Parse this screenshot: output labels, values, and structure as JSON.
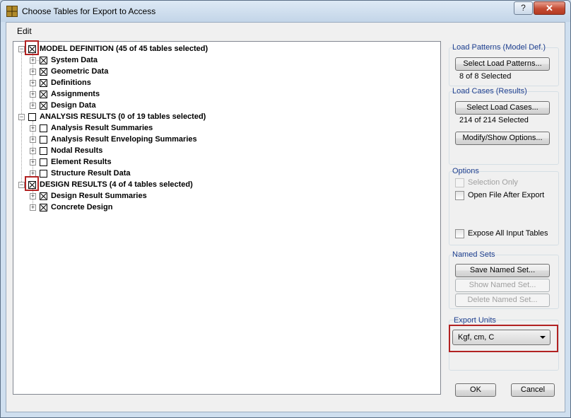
{
  "window": {
    "title": "Choose Tables for Export to Access",
    "help_glyph": "?",
    "close_glyph": "✕"
  },
  "menu": {
    "edit": "Edit"
  },
  "tree": {
    "model": {
      "label": "MODEL DEFINITION  (45 of 45 tables selected)",
      "children": [
        "System Data",
        "Geometric Data",
        "Definitions",
        "Assignments",
        "Design Data"
      ]
    },
    "analysis": {
      "label": "ANALYSIS RESULTS  (0 of 19 tables selected)",
      "children": [
        "Analysis Result Summaries",
        "Analysis Result Enveloping Summaries",
        "Nodal Results",
        "Element Results",
        "Structure Result Data"
      ]
    },
    "design": {
      "label": "DESIGN RESULTS  (4 of 4 tables selected)",
      "children": [
        "Design Result Summaries",
        "Concrete Design"
      ]
    },
    "expander_glyph": "+",
    "collapse_glyph": "−"
  },
  "load_patterns": {
    "title": "Load Patterns (Model Def.)",
    "button": "Select Load Patterns...",
    "status": "8 of 8 Selected"
  },
  "load_cases": {
    "title": "Load Cases (Results)",
    "button": "Select Load Cases...",
    "status": "214 of 214 Selected",
    "modify_button": "Modify/Show Options..."
  },
  "options": {
    "title": "Options",
    "selection_only": "Selection Only",
    "open_file": "Open File After Export",
    "expose_all": "Expose All Input Tables"
  },
  "named_sets": {
    "title": "Named Sets",
    "save": "Save Named Set...",
    "show": "Show Named Set...",
    "delete": "Delete Named Set..."
  },
  "export_units": {
    "title": "Export Units",
    "value": "Kgf, cm, C"
  },
  "footer": {
    "ok": "OK",
    "cancel": "Cancel"
  },
  "colors": {
    "highlight": "#b22222",
    "group_title": "#1f3f8f"
  }
}
